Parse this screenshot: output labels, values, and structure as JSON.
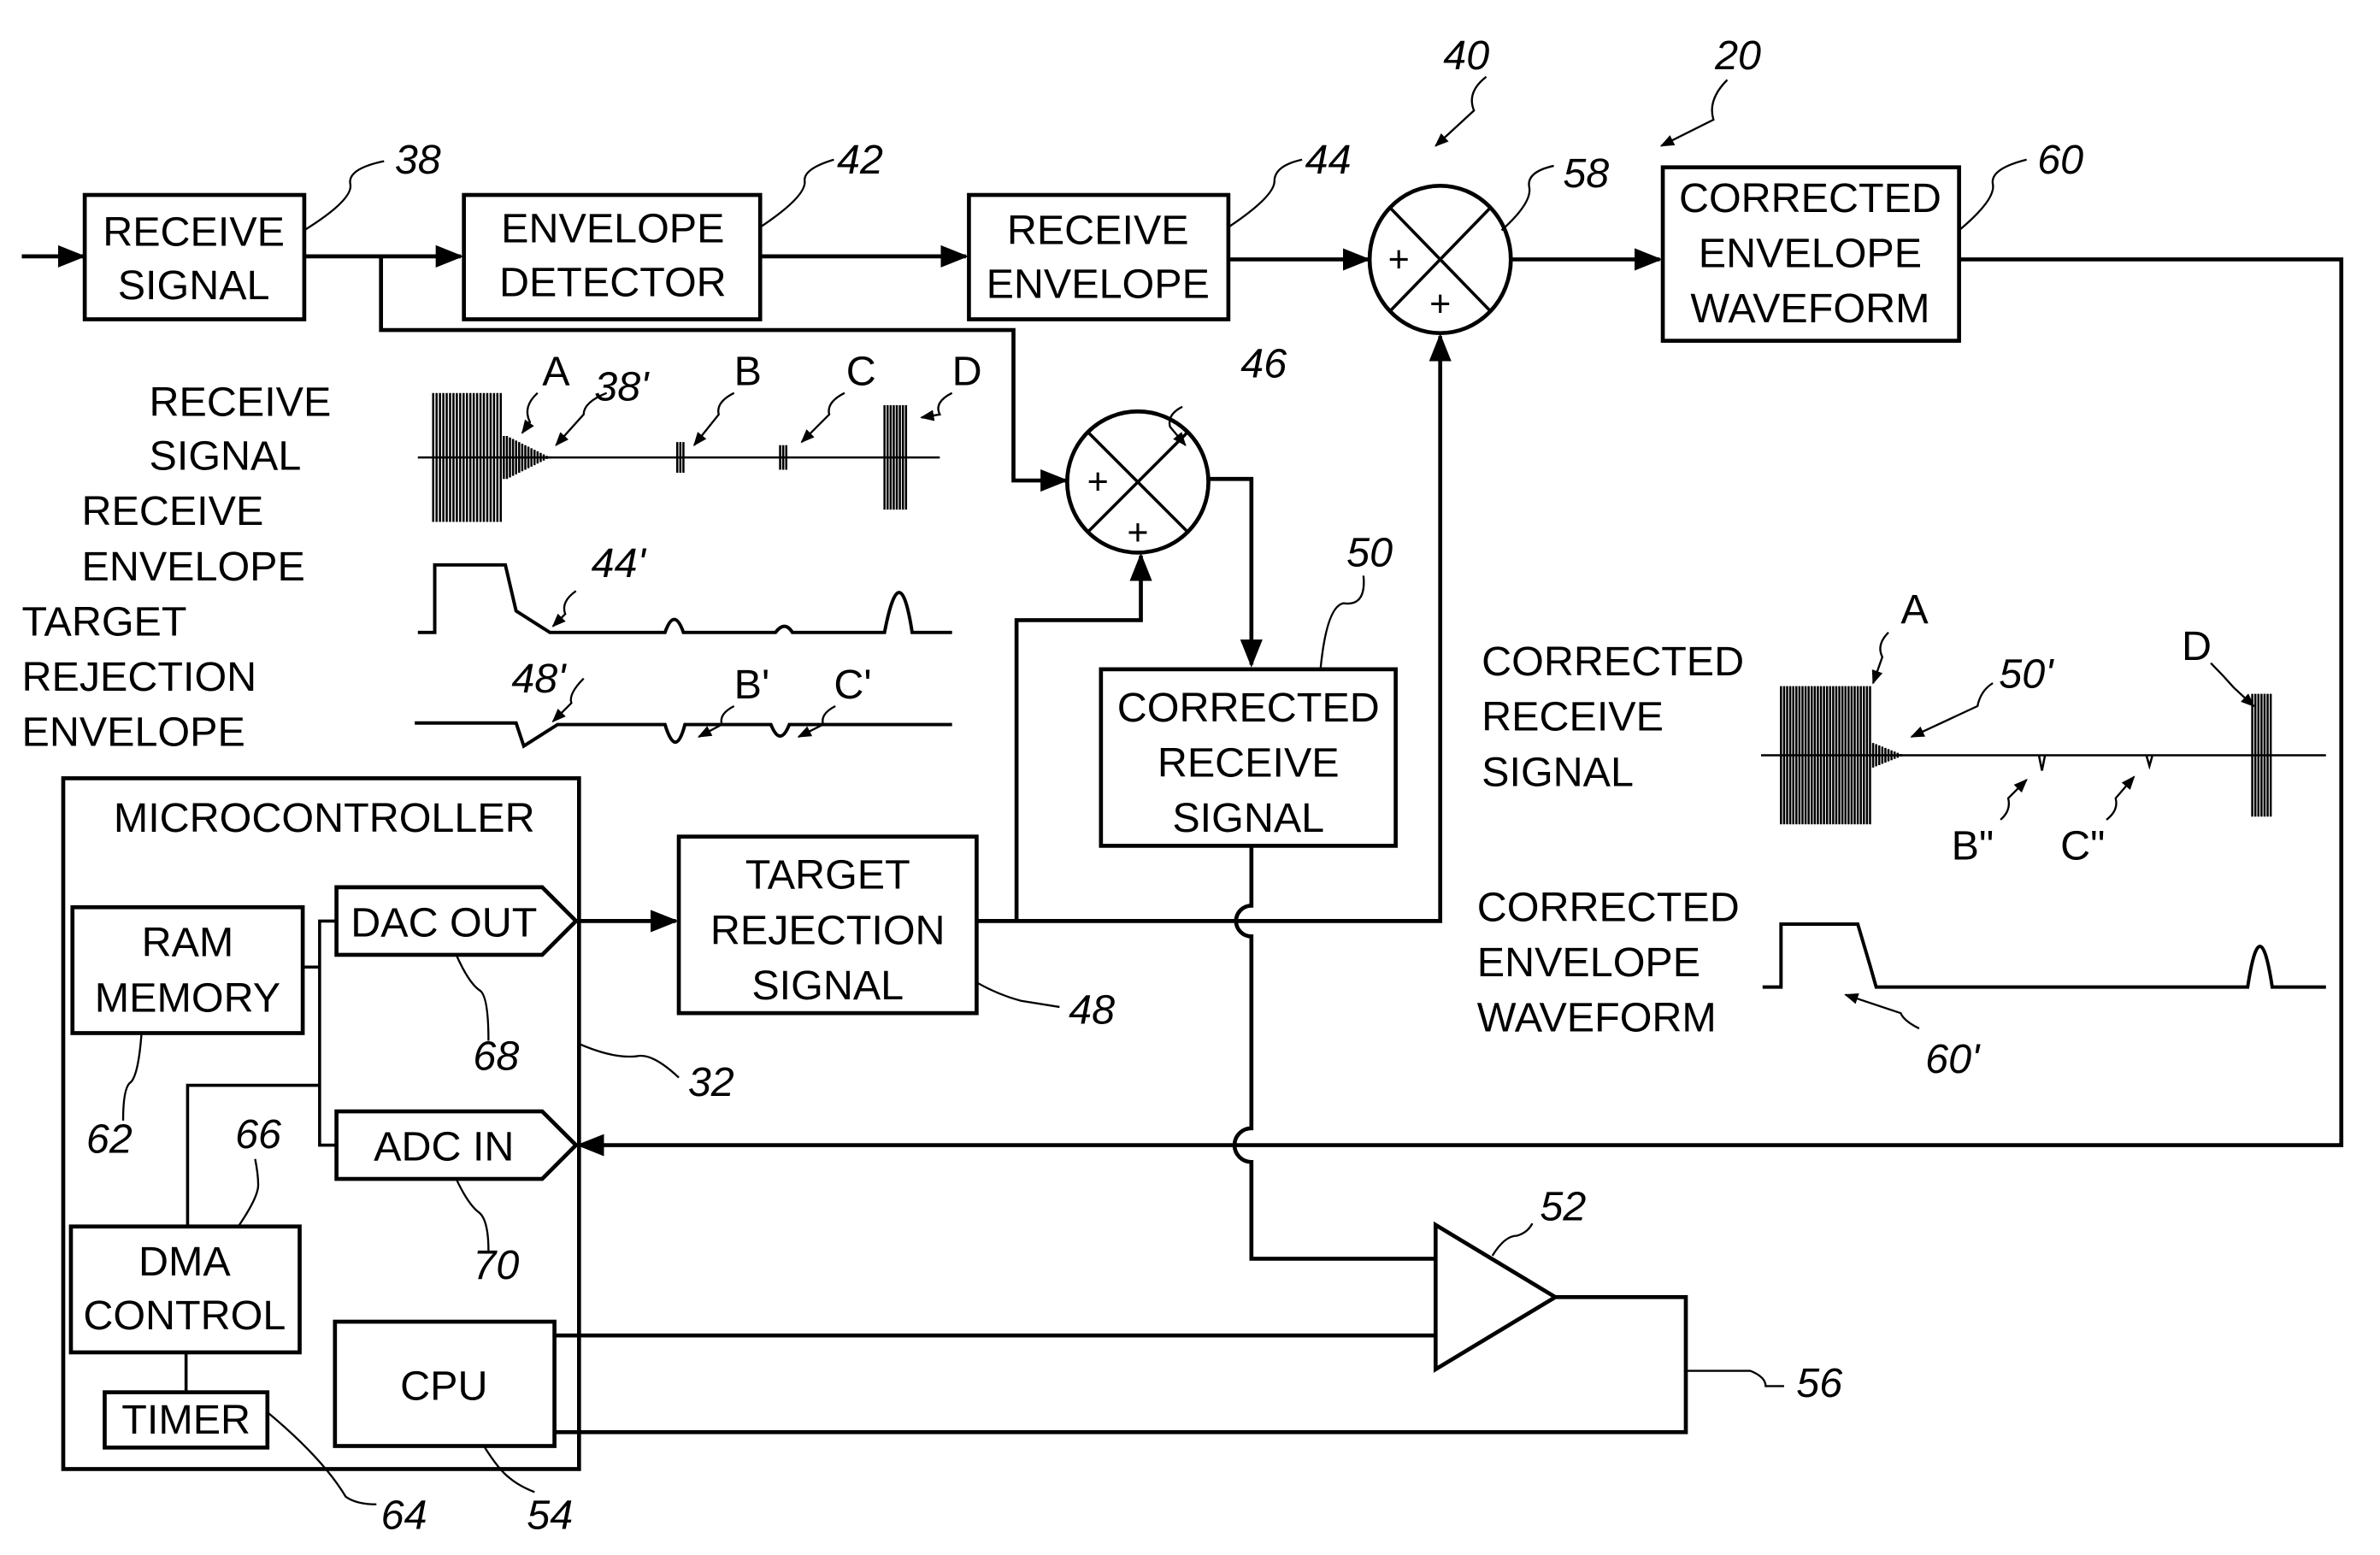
{
  "figure": {
    "blocks": {
      "receive_signal": [
        "RECEIVE",
        "SIGNAL"
      ],
      "envelope_detector": [
        "ENVELOPE",
        "DETECTOR"
      ],
      "receive_envelope": [
        "RECEIVE",
        "ENVELOPE"
      ],
      "corrected_envelope_waveform": [
        "CORRECTED",
        "ENVELOPE",
        "WAVEFORM"
      ],
      "corrected_receive_signal": [
        "CORRECTED",
        "RECEIVE",
        "SIGNAL"
      ],
      "target_rejection_signal": [
        "TARGET",
        "REJECTION",
        "SIGNAL"
      ],
      "microcontroller": "MICROCONTROLLER",
      "ram_memory": [
        "RAM",
        "MEMORY"
      ],
      "dac_out": "DAC OUT",
      "adc_in": "ADC IN",
      "dma_control": [
        "DMA",
        "CONTROL"
      ],
      "timer": "TIMER",
      "cpu": "CPU"
    },
    "summer_signs": [
      "+",
      "+"
    ],
    "waveform_labels": {
      "receive_signal": [
        "RECEIVE",
        "SIGNAL"
      ],
      "receive_envelope": [
        "RECEIVE",
        "ENVELOPE"
      ],
      "target_rejection_envelope": [
        "TARGET",
        "REJECTION",
        "ENVELOPE"
      ],
      "corrected_receive_signal": [
        "CORRECTED",
        "RECEIVE",
        "SIGNAL"
      ],
      "corrected_envelope_waveform": [
        "CORRECTED",
        "ENVELOPE",
        "WAVEFORM"
      ]
    },
    "echo_labels": {
      "top": [
        "A",
        "B",
        "C",
        "D"
      ],
      "rejection": [
        "B'",
        "C'"
      ],
      "corrected": [
        "A",
        "D",
        "B\"",
        "C\""
      ]
    },
    "reference_numerals": {
      "r20": "20",
      "r32": "32",
      "r38": "38",
      "r38p": "38'",
      "r40": "40",
      "r42": "42",
      "r44": "44",
      "r44p": "44'",
      "r46": "46",
      "r48": "48",
      "r48p": "48'",
      "r50": "50",
      "r50p": "50'",
      "r52": "52",
      "r54": "54",
      "r56": "56",
      "r58": "58",
      "r60": "60",
      "r60p": "60'",
      "r62": "62",
      "r64": "64",
      "r66": "66",
      "r68": "68",
      "r70": "70"
    }
  }
}
